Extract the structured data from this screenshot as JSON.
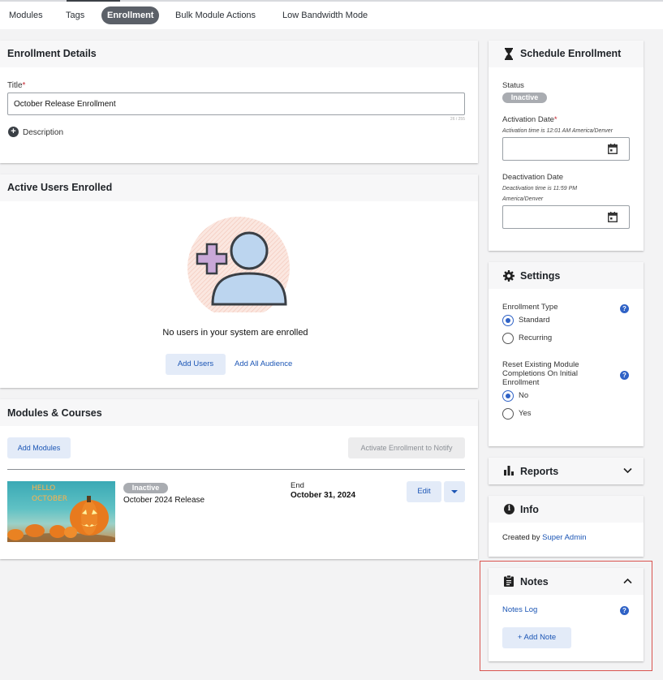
{
  "nav": {
    "tabs": [
      "Modules",
      "Tags",
      "Enrollment",
      "Bulk Module Actions",
      "Low Bandwidth Mode"
    ],
    "active": "Enrollment"
  },
  "enrollment_details": {
    "heading": "Enrollment Details",
    "title_label": "Title",
    "required_mark": "*",
    "title_value": "October Release Enrollment",
    "char_count": "26 / 255",
    "description_label": "Description"
  },
  "active_users": {
    "heading": "Active Users Enrolled",
    "empty_message": "No users in your system are enrolled",
    "add_users": "Add Users",
    "add_all_audience": "Add All Audience"
  },
  "modules_courses": {
    "heading": "Modules & Courses",
    "add_modules": "Add Modules",
    "activate_notify": "Activate Enrollment to Notify",
    "module": {
      "thumbnail_text_1": "HELLO",
      "thumbnail_text_2": "OCTOBER",
      "status": "Inactive",
      "name": "October 2024 Release",
      "end_label": "End",
      "end_date": "October 31, 2024",
      "edit": "Edit"
    }
  },
  "schedule": {
    "heading": "Schedule Enrollment",
    "status_label": "Status",
    "status_value": "Inactive",
    "activation_label": "Activation Date",
    "activation_hint": "Activation time is 12:01 AM America/Denver",
    "deactivation_label": "Deactivation Date",
    "deactivation_hint_1": "Deactivation time is 11:59 PM",
    "deactivation_hint_2": "America/Denver"
  },
  "settings": {
    "heading": "Settings",
    "enrollment_type_label": "Enrollment Type",
    "type_options": [
      "Standard",
      "Recurring"
    ],
    "type_selected": "Standard",
    "reset_label_1": "Reset Existing Module",
    "reset_label_2": "Completions On Initial",
    "reset_label_3": "Enrollment",
    "reset_options": [
      "No",
      "Yes"
    ],
    "reset_selected": "No",
    "help": "?"
  },
  "reports": {
    "heading": "Reports"
  },
  "info": {
    "heading": "Info",
    "created_by_label": "Created by",
    "created_by_user": "Super Admin"
  },
  "notes": {
    "heading": "Notes",
    "notes_log": "Notes Log",
    "add_note": "+ Add Note"
  },
  "colors": {
    "accent_blue": "#2f62c6",
    "link_blue": "#1c56b5",
    "highlight_red": "#d9534f",
    "badge_gray": "#a9acb1"
  }
}
